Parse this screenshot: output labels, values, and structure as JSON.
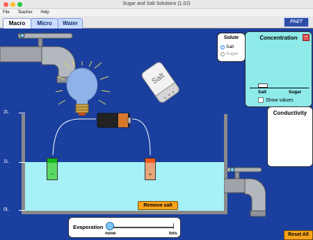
{
  "window": {
    "title": "Sugar and Salt Solutions (1.02)"
  },
  "menu": {
    "items": [
      "File",
      "Teacher",
      "Help"
    ]
  },
  "tabs": [
    {
      "label": "Macro",
      "active": true
    },
    {
      "label": "Micro",
      "active": false
    },
    {
      "label": "Water",
      "active": false
    }
  ],
  "logo": {
    "text": "PhET"
  },
  "solute": {
    "header": "Solute",
    "options": [
      "Salt",
      "Sugar"
    ],
    "selected": "Salt"
  },
  "concentration": {
    "header": "Concentration",
    "min_button": "−",
    "labels": [
      "Salt",
      "Sugar"
    ],
    "show_values_label": "Show values",
    "show_values_checked": false
  },
  "conductivity": {
    "header": "Conductivity"
  },
  "shaker": {
    "label": "Salt"
  },
  "beaker": {
    "tick_labels": [
      "2L",
      "1L",
      "0L"
    ]
  },
  "electrodes": {
    "negative": "−",
    "positive": "+"
  },
  "buttons": {
    "remove_salt": "Remove salt",
    "reset_all": "Reset All"
  },
  "evaporation": {
    "label": "Evaporation",
    "min_label": "none",
    "max_label": "lots"
  },
  "colors": {
    "background": "#1a3f9e",
    "water": "#a6f1f7",
    "accent_orange": "#f7a21b"
  }
}
